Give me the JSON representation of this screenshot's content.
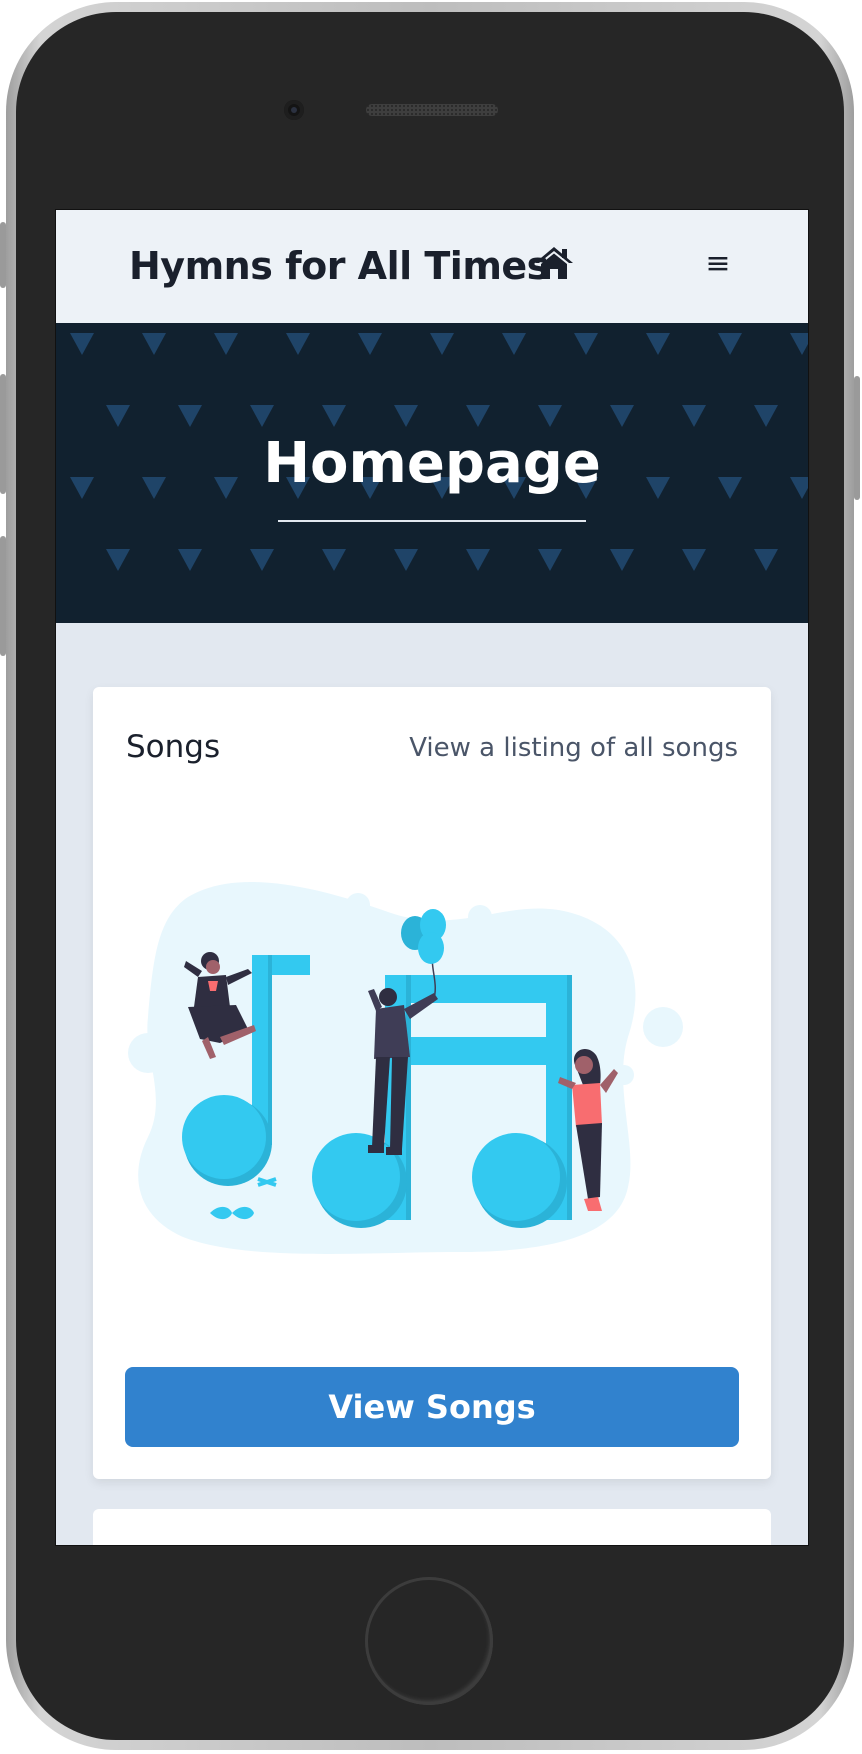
{
  "navbar": {
    "brand": "Hymns for All Times",
    "home_icon": "home-icon",
    "menu_icon": "hamburger-menu-icon",
    "menu_glyph": "≡"
  },
  "hero": {
    "title": "Homepage"
  },
  "songs_card": {
    "title": "Songs",
    "subtitle": "View a listing of all songs",
    "button_label": "View Songs",
    "illustration": "music-notes-people-illustration"
  },
  "colors": {
    "navbar_bg": "#edf2f7",
    "hero_bg": "#11212f",
    "hero_pattern": "#1f4468",
    "page_bg": "#e2e8f0",
    "accent_button": "#3182ce",
    "illustration_note": "#33c9f0"
  }
}
